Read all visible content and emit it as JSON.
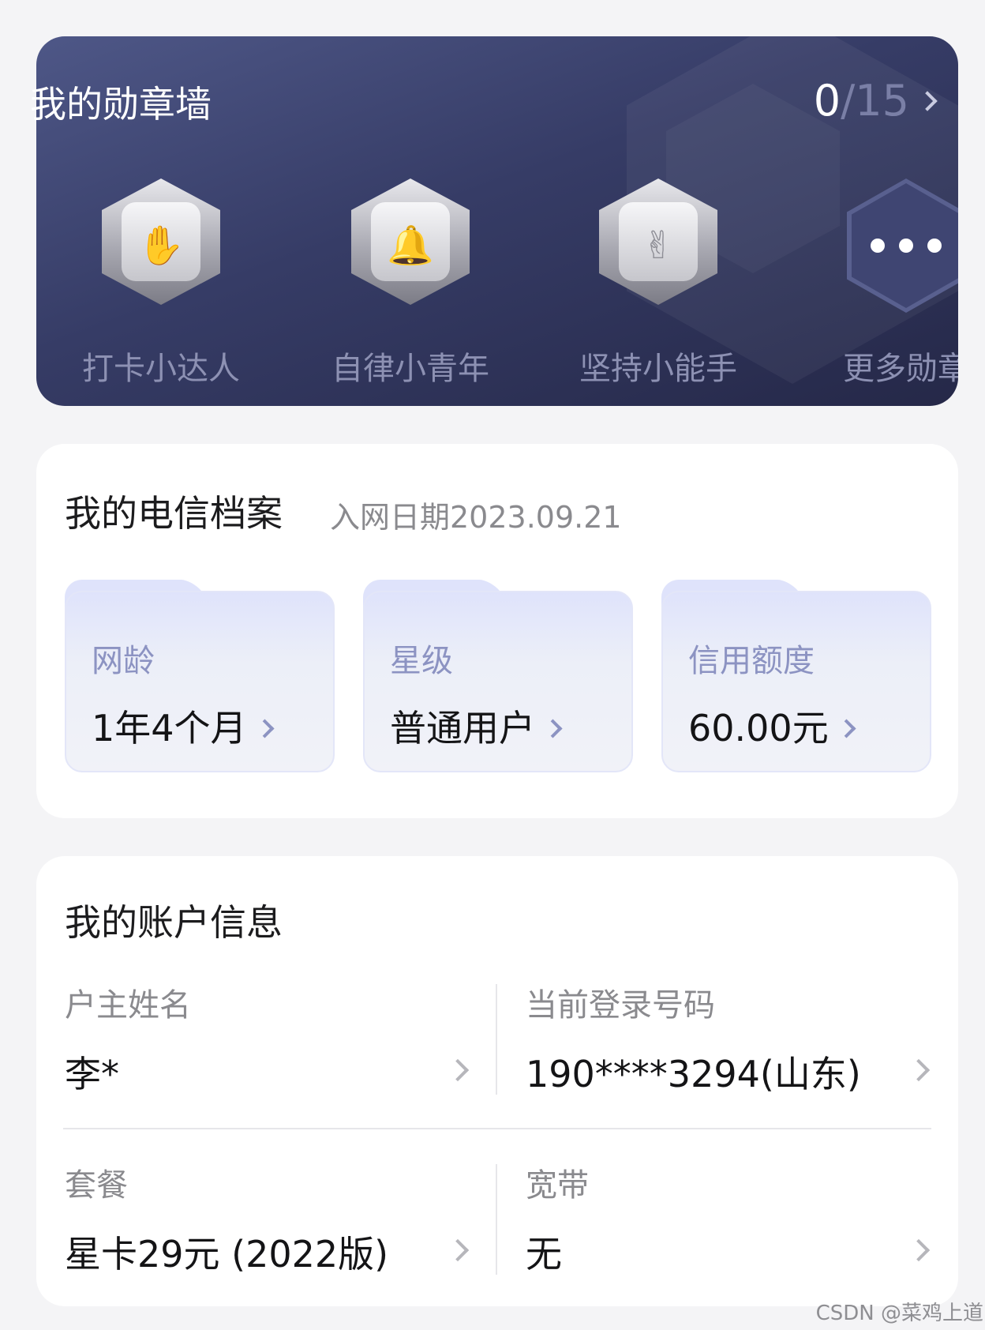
{
  "medal_wall": {
    "title": "我的勋章墙",
    "earned": "0",
    "total": "/15",
    "medals": [
      {
        "label": "打卡小达人",
        "icon": "hands-calendar-medal-icon"
      },
      {
        "label": "自律小青年",
        "icon": "hands-bell-medal-icon"
      },
      {
        "label": "坚持小能手",
        "icon": "hand-victory-medal-icon"
      },
      {
        "label": "更多勋章",
        "icon": "more-dots-icon"
      }
    ]
  },
  "profile": {
    "title": "我的电信档案",
    "join_date": "入网日期2023.09.21",
    "items": [
      {
        "label": "网龄",
        "value": "1年4个月"
      },
      {
        "label": "星级",
        "value": "普通用户"
      },
      {
        "label": "信用额度",
        "value": "60.00元"
      }
    ]
  },
  "account": {
    "title": "我的账户信息",
    "owner_label": "户主姓名",
    "owner_value": "李*",
    "phone_label": "当前登录号码",
    "phone_value": "190****3294(山东)",
    "plan_label": "套餐",
    "plan_value": "星卡29元 (2022版)",
    "broadband_label": "宽带",
    "broadband_value": "无"
  },
  "watermark": "CSDN @菜鸡上道"
}
